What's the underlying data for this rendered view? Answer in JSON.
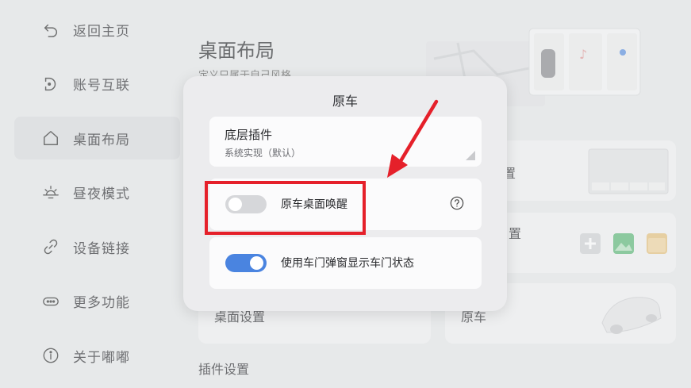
{
  "sidebar": {
    "items": [
      {
        "label": "返回主页",
        "icon": "back-arrow-icon"
      },
      {
        "label": "账号互联",
        "icon": "account-link-icon"
      },
      {
        "label": "桌面布局",
        "icon": "home-icon",
        "active": true
      },
      {
        "label": "昼夜模式",
        "icon": "sun-icon"
      },
      {
        "label": "设备链接",
        "icon": "link-icon"
      },
      {
        "label": "更多功能",
        "icon": "more-icon"
      },
      {
        "label": "关于嘟嘟",
        "icon": "info-icon"
      }
    ]
  },
  "main": {
    "title": "桌面布局",
    "subtitle": "定义只属于自己风格",
    "cards": {
      "card1_label": "置",
      "card2_label": "置",
      "card3_label": "桌面设置",
      "card4_label": "原车"
    },
    "section_title": "插件设置"
  },
  "dialog": {
    "title": "原车",
    "plugin": {
      "title": "底层插件",
      "value": "系统实现（默认）"
    },
    "wake_toggle": {
      "label": "原车桌面唤醒",
      "on": false
    },
    "door_toggle": {
      "label": "使用车门弹窗显示车门状态",
      "on": true
    }
  },
  "colors": {
    "accent": "#4a84e0",
    "highlight": "#e5202a",
    "background": "#e9eaec"
  }
}
